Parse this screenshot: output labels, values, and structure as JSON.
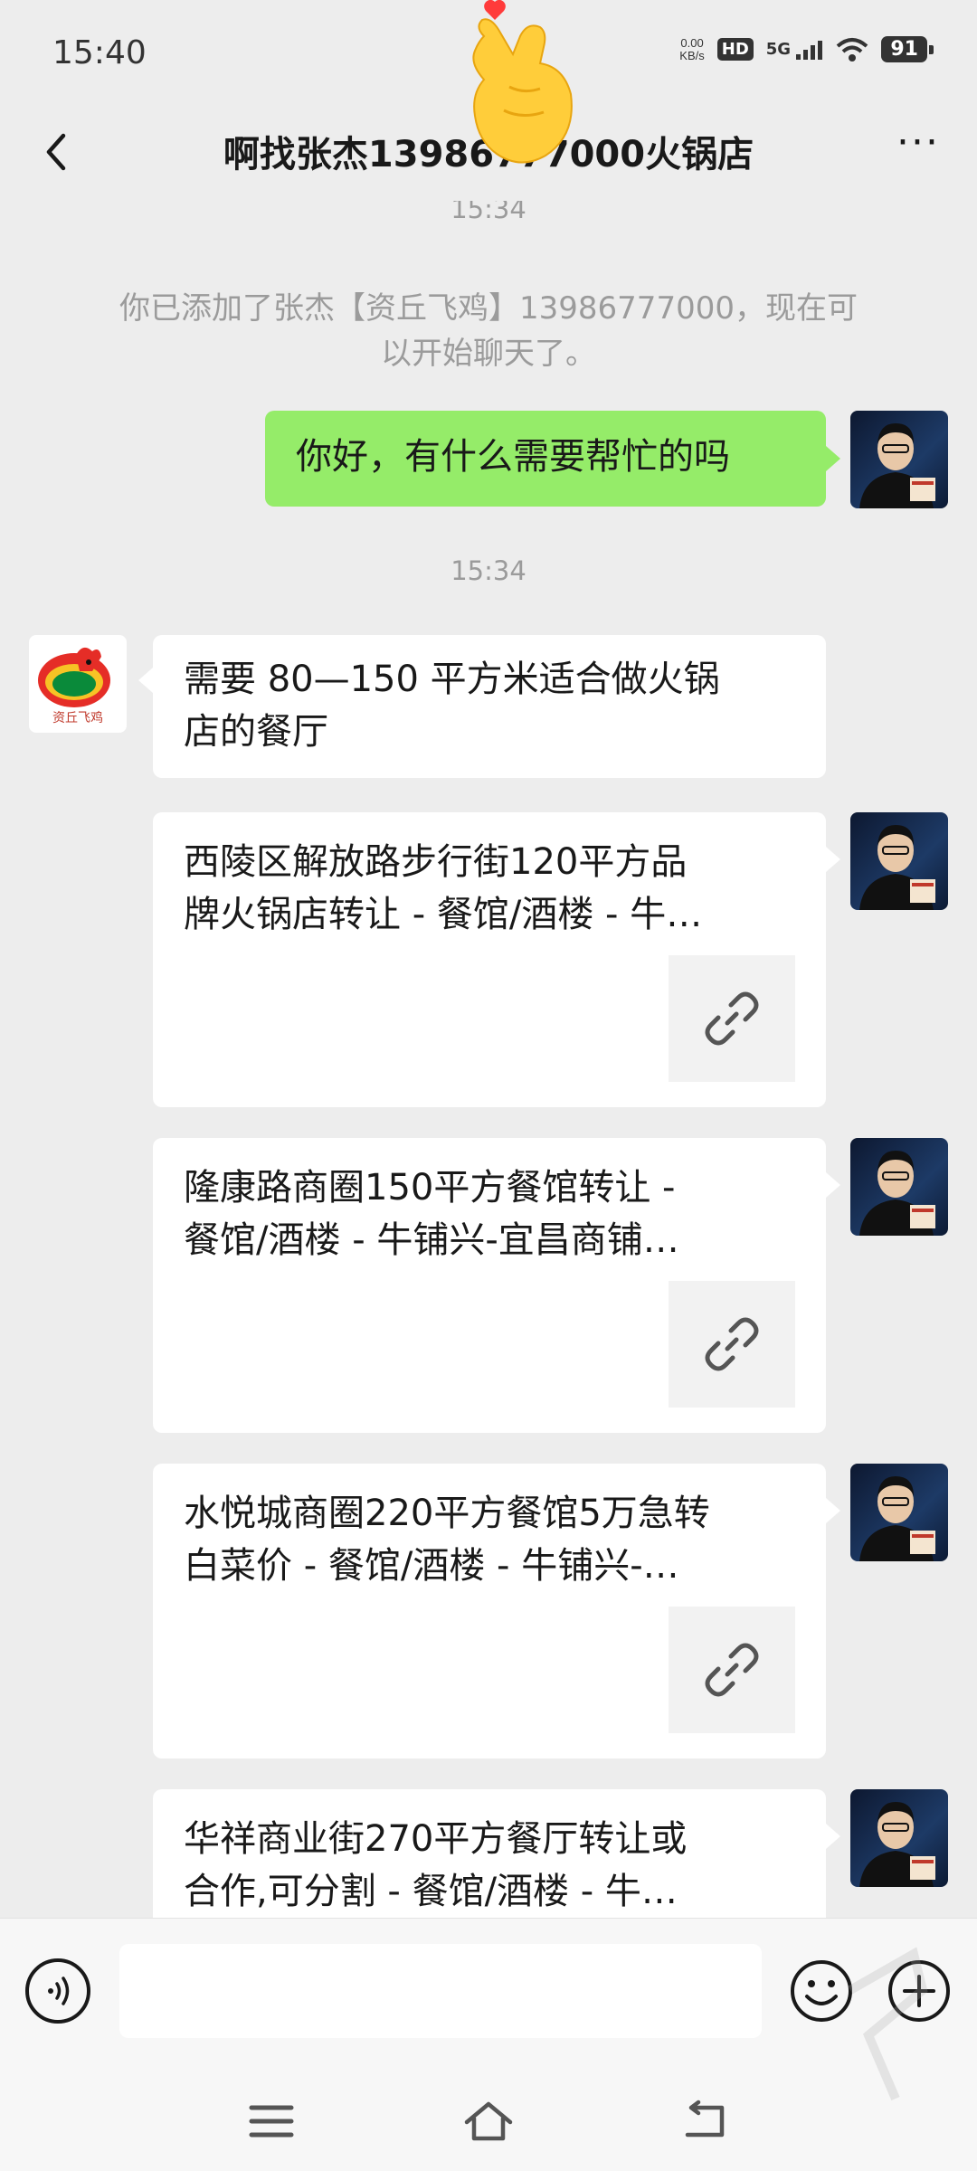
{
  "status_bar": {
    "time": "15:40",
    "speed_value": "0.00",
    "speed_unit": "KB/s",
    "hd": "HD",
    "network": "5G",
    "battery": "91"
  },
  "header": {
    "title": "啊找张杰13986777000火锅店",
    "back_icon": "chevron-left-icon",
    "more_icon": "ellipsis-icon"
  },
  "chat": {
    "top_timestamp": "15:34",
    "system_line1": "你已添加了张杰【资丘飞鸡】13986777000，现在可",
    "system_line2": "以开始聊天了。",
    "greeting": "你好，有什么需要帮忙的吗",
    "timestamp2": "15:34",
    "contact_logo_text": "资丘飞鸡",
    "request_line1": "需要 80—150 平方米适合做火锅",
    "request_line2": "店的餐厅",
    "links": [
      {
        "line1": "西陵区解放路步行街120平方品",
        "line2": "牌火锅店转让 - 餐馆/酒楼 - 牛…"
      },
      {
        "line1": "隆康路商圈150平方餐馆转让 -",
        "line2": "餐馆/酒楼 - 牛铺兴-宜昌商铺…"
      },
      {
        "line1": "水悦城商圈220平方餐馆5万急转",
        "line2": "白菜价 - 餐馆/酒楼 - 牛铺兴-…"
      },
      {
        "line1": "华祥商业街270平方餐厅转让或",
        "line2": "合作,可分割 - 餐馆/酒楼 - 牛…"
      }
    ]
  },
  "input_bar": {
    "voice_icon": "voice-icon",
    "emoji_icon": "emoji-icon",
    "plus_icon": "plus-icon",
    "message_value": ""
  },
  "nav_bar": {
    "menu_icon": "menu-icon",
    "home_icon": "home-icon",
    "back_icon": "back-icon"
  },
  "colors": {
    "background": "#ededed",
    "sent_bubble": "#95ec69",
    "received_bubble": "#ffffff",
    "timestamp_text": "#9b9b9b"
  }
}
